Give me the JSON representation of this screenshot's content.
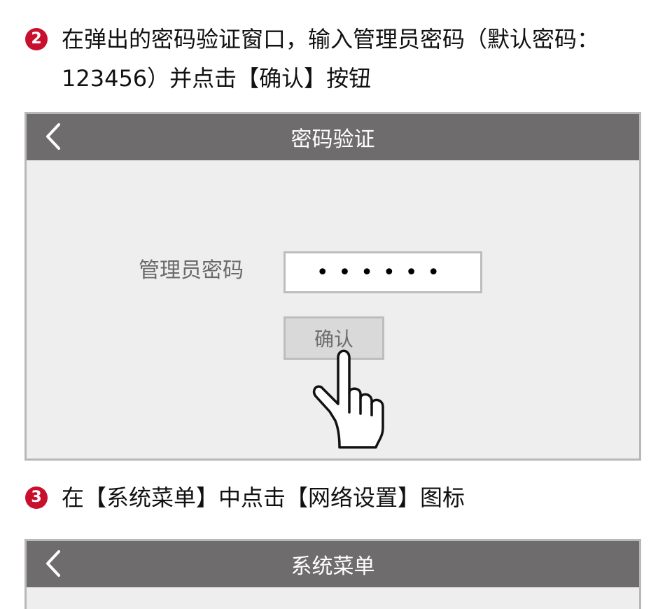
{
  "step2": {
    "number": "2",
    "line1": "在弹出的密码验证窗口，输入管理员密码（默认密码：",
    "line2": "123456）并点击【确认】按钮"
  },
  "screen1": {
    "title": "密码验证",
    "back_icon": "chevron-left-icon",
    "password_label": "管理员密码",
    "password_value": "••••••",
    "confirm_label": "确认",
    "pointer_icon": "hand-pointer-icon"
  },
  "step3": {
    "number": "3",
    "text": "在【系统菜单】中点击【网络设置】图标"
  },
  "screen2": {
    "title": "系统菜单",
    "back_icon": "chevron-left-icon"
  },
  "colors": {
    "step_badge": "#c8102e",
    "titlebar": "#6e6c6d",
    "screen_bg": "#eeeeee",
    "border": "#b8b8b8"
  }
}
